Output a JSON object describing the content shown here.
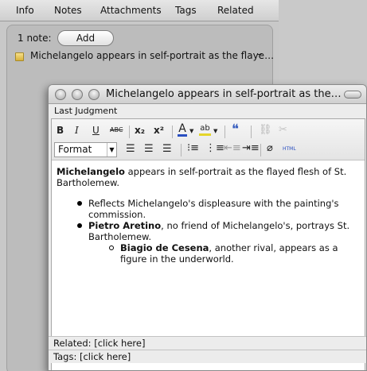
{
  "tabs": [
    "Info",
    "Notes",
    "Attachments",
    "Tags",
    "Related"
  ],
  "notes_panel": {
    "count_label": "1 note:",
    "add_label": "Add",
    "note_title": "Michelangelo appears in self-portrait as the flaye…",
    "row_menu": "–"
  },
  "note_window": {
    "title": "Michelangelo appears in self-portrait as the…",
    "parent_item": "Last Judgment",
    "toolbar": {
      "bold": "B",
      "italic": "I",
      "underline": "U",
      "strike": "ABC",
      "subscript": "x₂",
      "superscript": "x²",
      "text_color": "A",
      "highlight": "ab",
      "blockquote": "❝",
      "format_value": "Format",
      "html": "HTML"
    },
    "content": {
      "p1_bold": "Michelangelo",
      "p1_rest": " appears in self-portrait as the flayed flesh of St. Bartholemew.",
      "b1": "Reflects Michelangelo's displeasure with the painting's commission.",
      "b2_bold": "Pietro Aretino",
      "b2_rest": ", no friend of Michelangelo's, portrays St. Bartholemew.",
      "s1_bold": "Biagio de Cesena",
      "s1_rest": ", another rival, appears as a figure in the underworld."
    },
    "footer": {
      "related": "Related: [click here]",
      "tags": "Tags: [click here]"
    }
  }
}
